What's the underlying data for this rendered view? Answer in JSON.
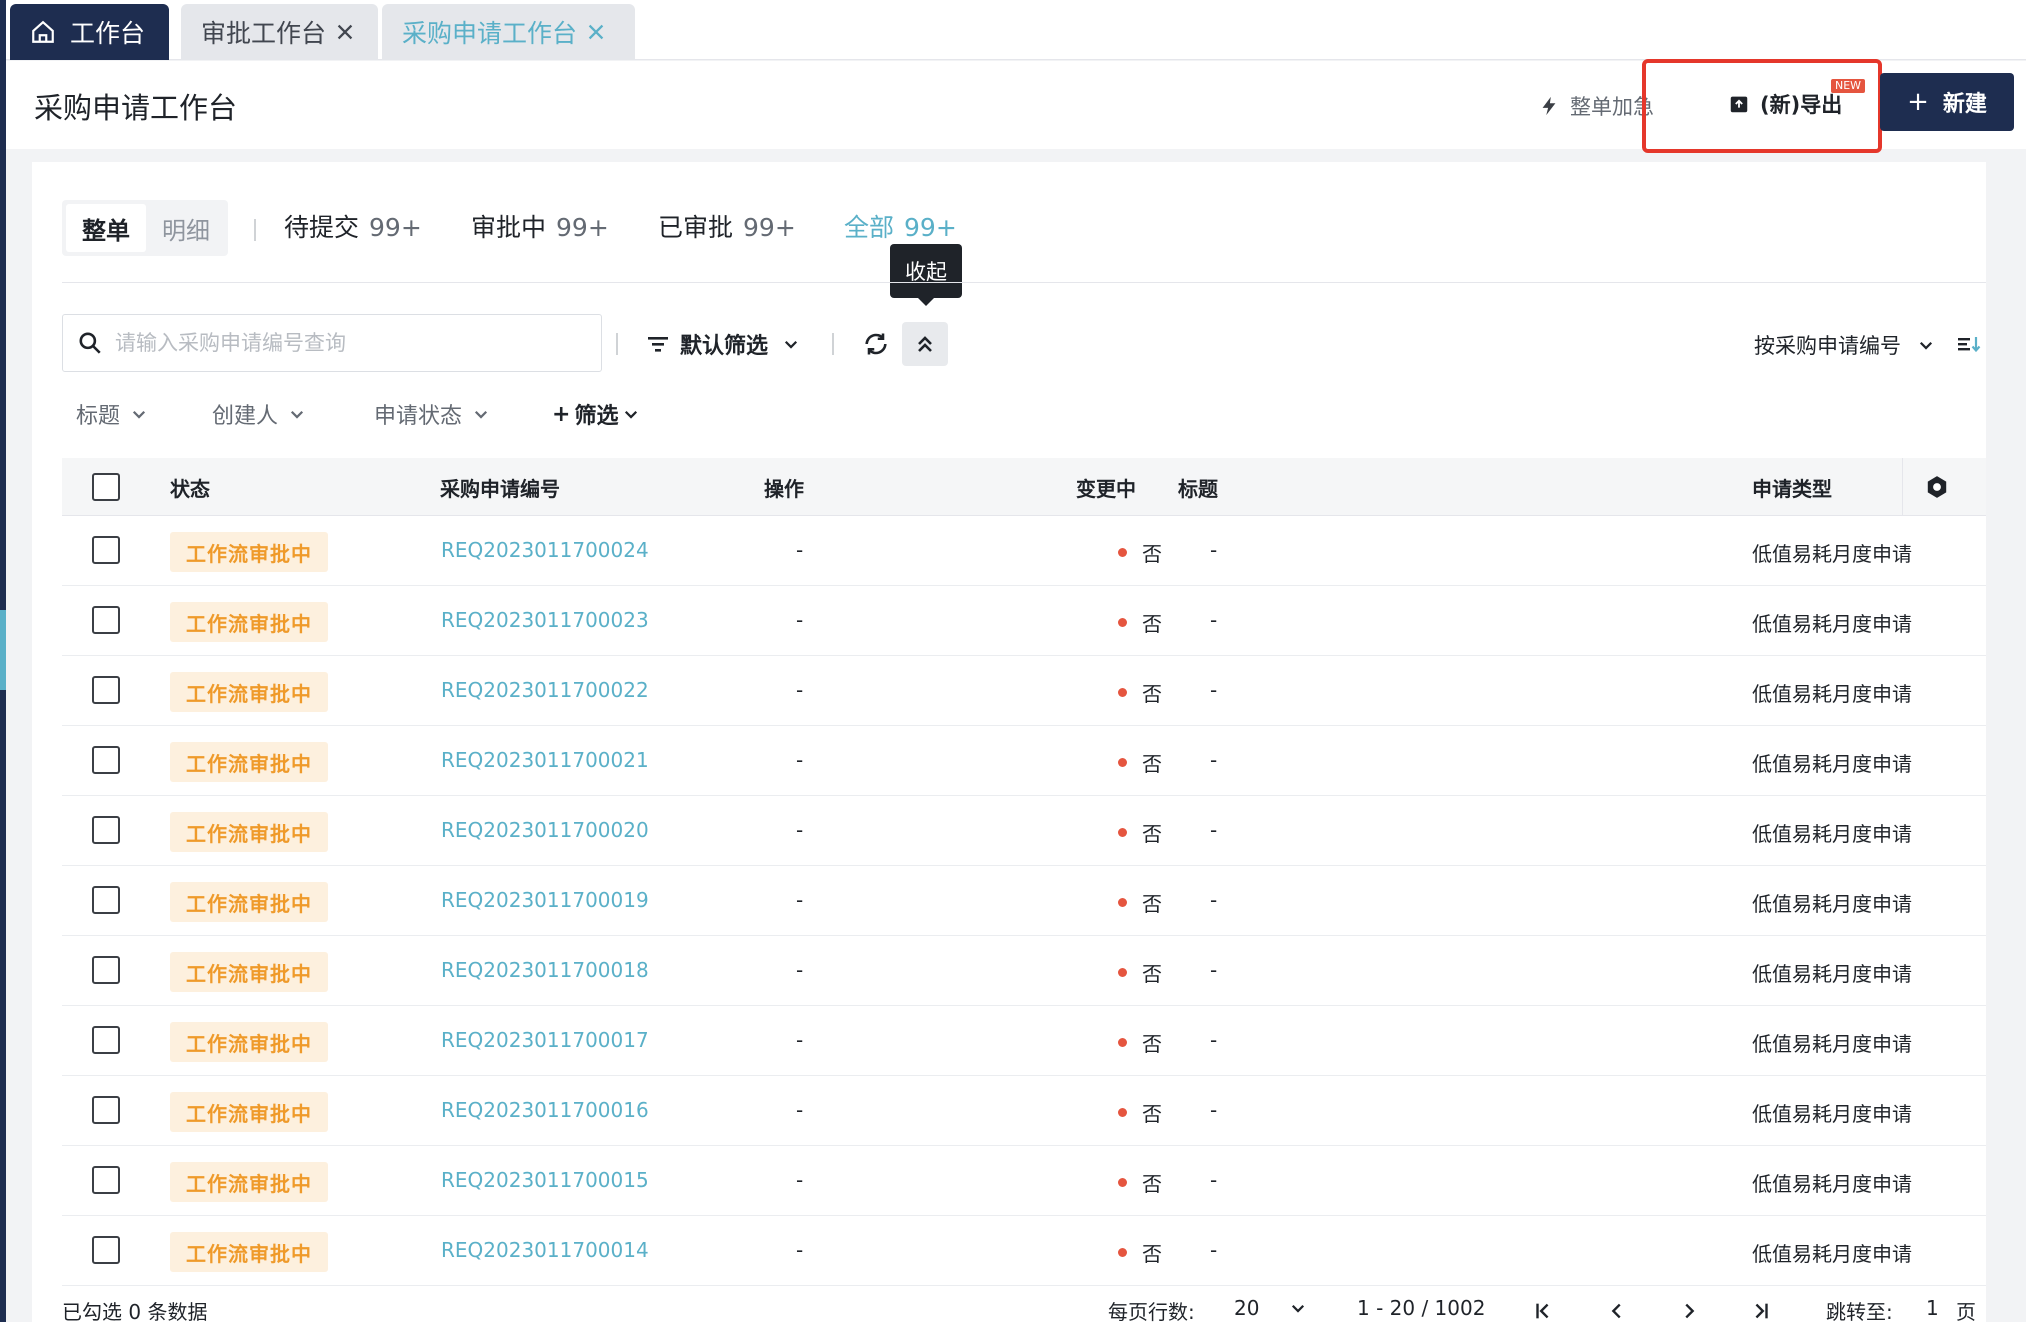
{
  "tabs": {
    "home": "工作台",
    "approval": "审批工作台",
    "purchase": "采购申请工作台"
  },
  "header": {
    "title": "采购申请工作台",
    "urgent_label": "整单加急",
    "export_label": "(新)导出",
    "new_badge": "NEW",
    "create_label": "新建"
  },
  "view_toggle": {
    "whole": "整单",
    "detail": "明细"
  },
  "status_tabs": [
    {
      "label": "待提交",
      "count": "99+"
    },
    {
      "label": "审批中",
      "count": "99+"
    },
    {
      "label": "已审批",
      "count": "99+"
    },
    {
      "label": "全部",
      "count": "99+"
    }
  ],
  "tooltip": "收起",
  "search": {
    "placeholder": "请输入采购申请编号查询",
    "filter_label": "默认筛选",
    "sort_label": "按采购申请编号"
  },
  "chips": [
    "标题",
    "创建人",
    "申请状态",
    "筛选"
  ],
  "columns": {
    "status": "状态",
    "code": "采购申请编号",
    "op": "操作",
    "changing": "变更中",
    "title": "标题",
    "type": "申请类型"
  },
  "rows": [
    {
      "status": "工作流审批中",
      "code": "REQ2023011700024",
      "op": "-",
      "changing": "否",
      "title": "-",
      "type": "低值易耗月度申请"
    },
    {
      "status": "工作流审批中",
      "code": "REQ2023011700023",
      "op": "-",
      "changing": "否",
      "title": "-",
      "type": "低值易耗月度申请"
    },
    {
      "status": "工作流审批中",
      "code": "REQ2023011700022",
      "op": "-",
      "changing": "否",
      "title": "-",
      "type": "低值易耗月度申请"
    },
    {
      "status": "工作流审批中",
      "code": "REQ2023011700021",
      "op": "-",
      "changing": "否",
      "title": "-",
      "type": "低值易耗月度申请"
    },
    {
      "status": "工作流审批中",
      "code": "REQ2023011700020",
      "op": "-",
      "changing": "否",
      "title": "-",
      "type": "低值易耗月度申请"
    },
    {
      "status": "工作流审批中",
      "code": "REQ2023011700019",
      "op": "-",
      "changing": "否",
      "title": "-",
      "type": "低值易耗月度申请"
    },
    {
      "status": "工作流审批中",
      "code": "REQ2023011700018",
      "op": "-",
      "changing": "否",
      "title": "-",
      "type": "低值易耗月度申请"
    },
    {
      "status": "工作流审批中",
      "code": "REQ2023011700017",
      "op": "-",
      "changing": "否",
      "title": "-",
      "type": "低值易耗月度申请"
    },
    {
      "status": "工作流审批中",
      "code": "REQ2023011700016",
      "op": "-",
      "changing": "否",
      "title": "-",
      "type": "低值易耗月度申请"
    },
    {
      "status": "工作流审批中",
      "code": "REQ2023011700015",
      "op": "-",
      "changing": "否",
      "title": "-",
      "type": "低值易耗月度申请"
    },
    {
      "status": "工作流审批中",
      "code": "REQ2023011700014",
      "op": "-",
      "changing": "否",
      "title": "-",
      "type": "低值易耗月度申请"
    }
  ],
  "footer": {
    "selected": "已勾选 0 条数据",
    "rows_per_page_label": "每页行数:",
    "rows_per_page": "20",
    "range": "1 - 20 / 1002",
    "jump_label": "跳转至:",
    "jump_value": "1",
    "page_unit": "页"
  },
  "colors": {
    "navy": "#1e2d50",
    "accent": "#5ab0c8",
    "badge_bg": "#fdf0de",
    "badge_fg": "#ef9a2a",
    "dot": "#e5553f",
    "highlight": "#e5372b"
  }
}
